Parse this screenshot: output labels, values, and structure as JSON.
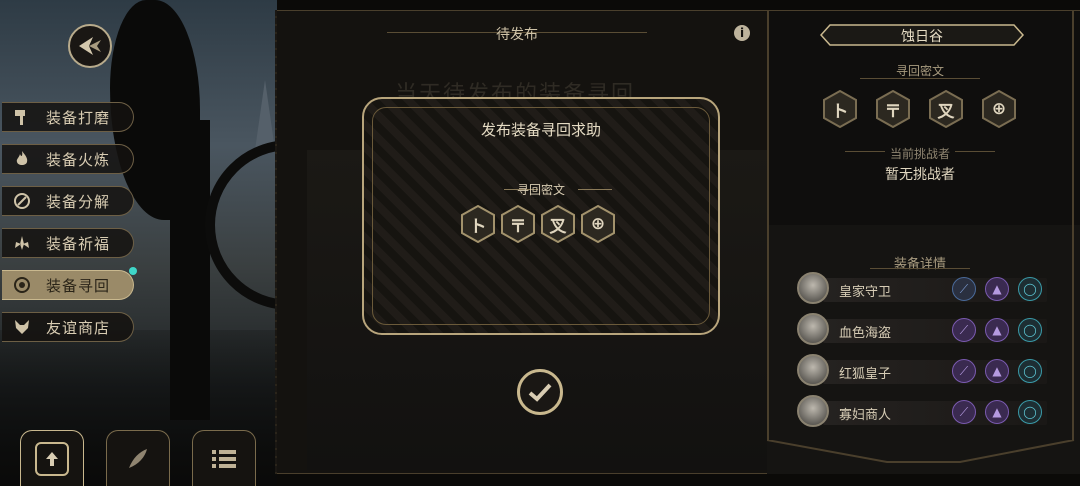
{
  "menu": {
    "items": [
      {
        "label": "装备打磨",
        "icon": "hammer-icon"
      },
      {
        "label": "装备火炼",
        "icon": "flame-icon"
      },
      {
        "label": "装备分解",
        "icon": "disassemble-icon"
      },
      {
        "label": "装备祈福",
        "icon": "blessing-icon"
      },
      {
        "label": "装备寻回",
        "icon": "target-icon"
      },
      {
        "label": "友谊商店",
        "icon": "fox-icon"
      }
    ],
    "active_index": 4
  },
  "bottom_tabs": [
    {
      "icon": "upload-icon"
    },
    {
      "icon": "feather-icon"
    },
    {
      "icon": "list-icon"
    }
  ],
  "middle": {
    "tab_title": "待发布",
    "bg_heading": "当天待发布的装备寻回",
    "info_icon": "info-icon"
  },
  "dialog": {
    "title": "发布装备寻回求助",
    "cipher_label": "寻回密文",
    "glyphs": [
      "ト",
      "〒",
      "叉",
      "⊕"
    ],
    "confirm_icon": "checkmark-icon"
  },
  "right_panel": {
    "location": "蚀日谷",
    "cipher_label": "寻回密文",
    "glyphs": [
      "ト",
      "〒",
      "叉",
      "⊕"
    ],
    "challenger_label": "当前挑战者",
    "challenger_value": "暂无挑战者",
    "details_label": "装备详情",
    "characters": [
      {
        "name": "皇家守卫",
        "avatar": "royal-guard-avatar"
      },
      {
        "name": "血色海盗",
        "avatar": "crimson-pirate-avatar"
      },
      {
        "name": "红狐皇子",
        "avatar": "red-fox-prince-avatar"
      },
      {
        "name": "寡妇商人",
        "avatar": "widow-merchant-avatar"
      }
    ]
  },
  "colors": {
    "gold": "#c9b88e",
    "panel_border": "#6b5a3a",
    "slot_purple": "#6a4fa0",
    "slot_teal": "#3a9aa8"
  }
}
